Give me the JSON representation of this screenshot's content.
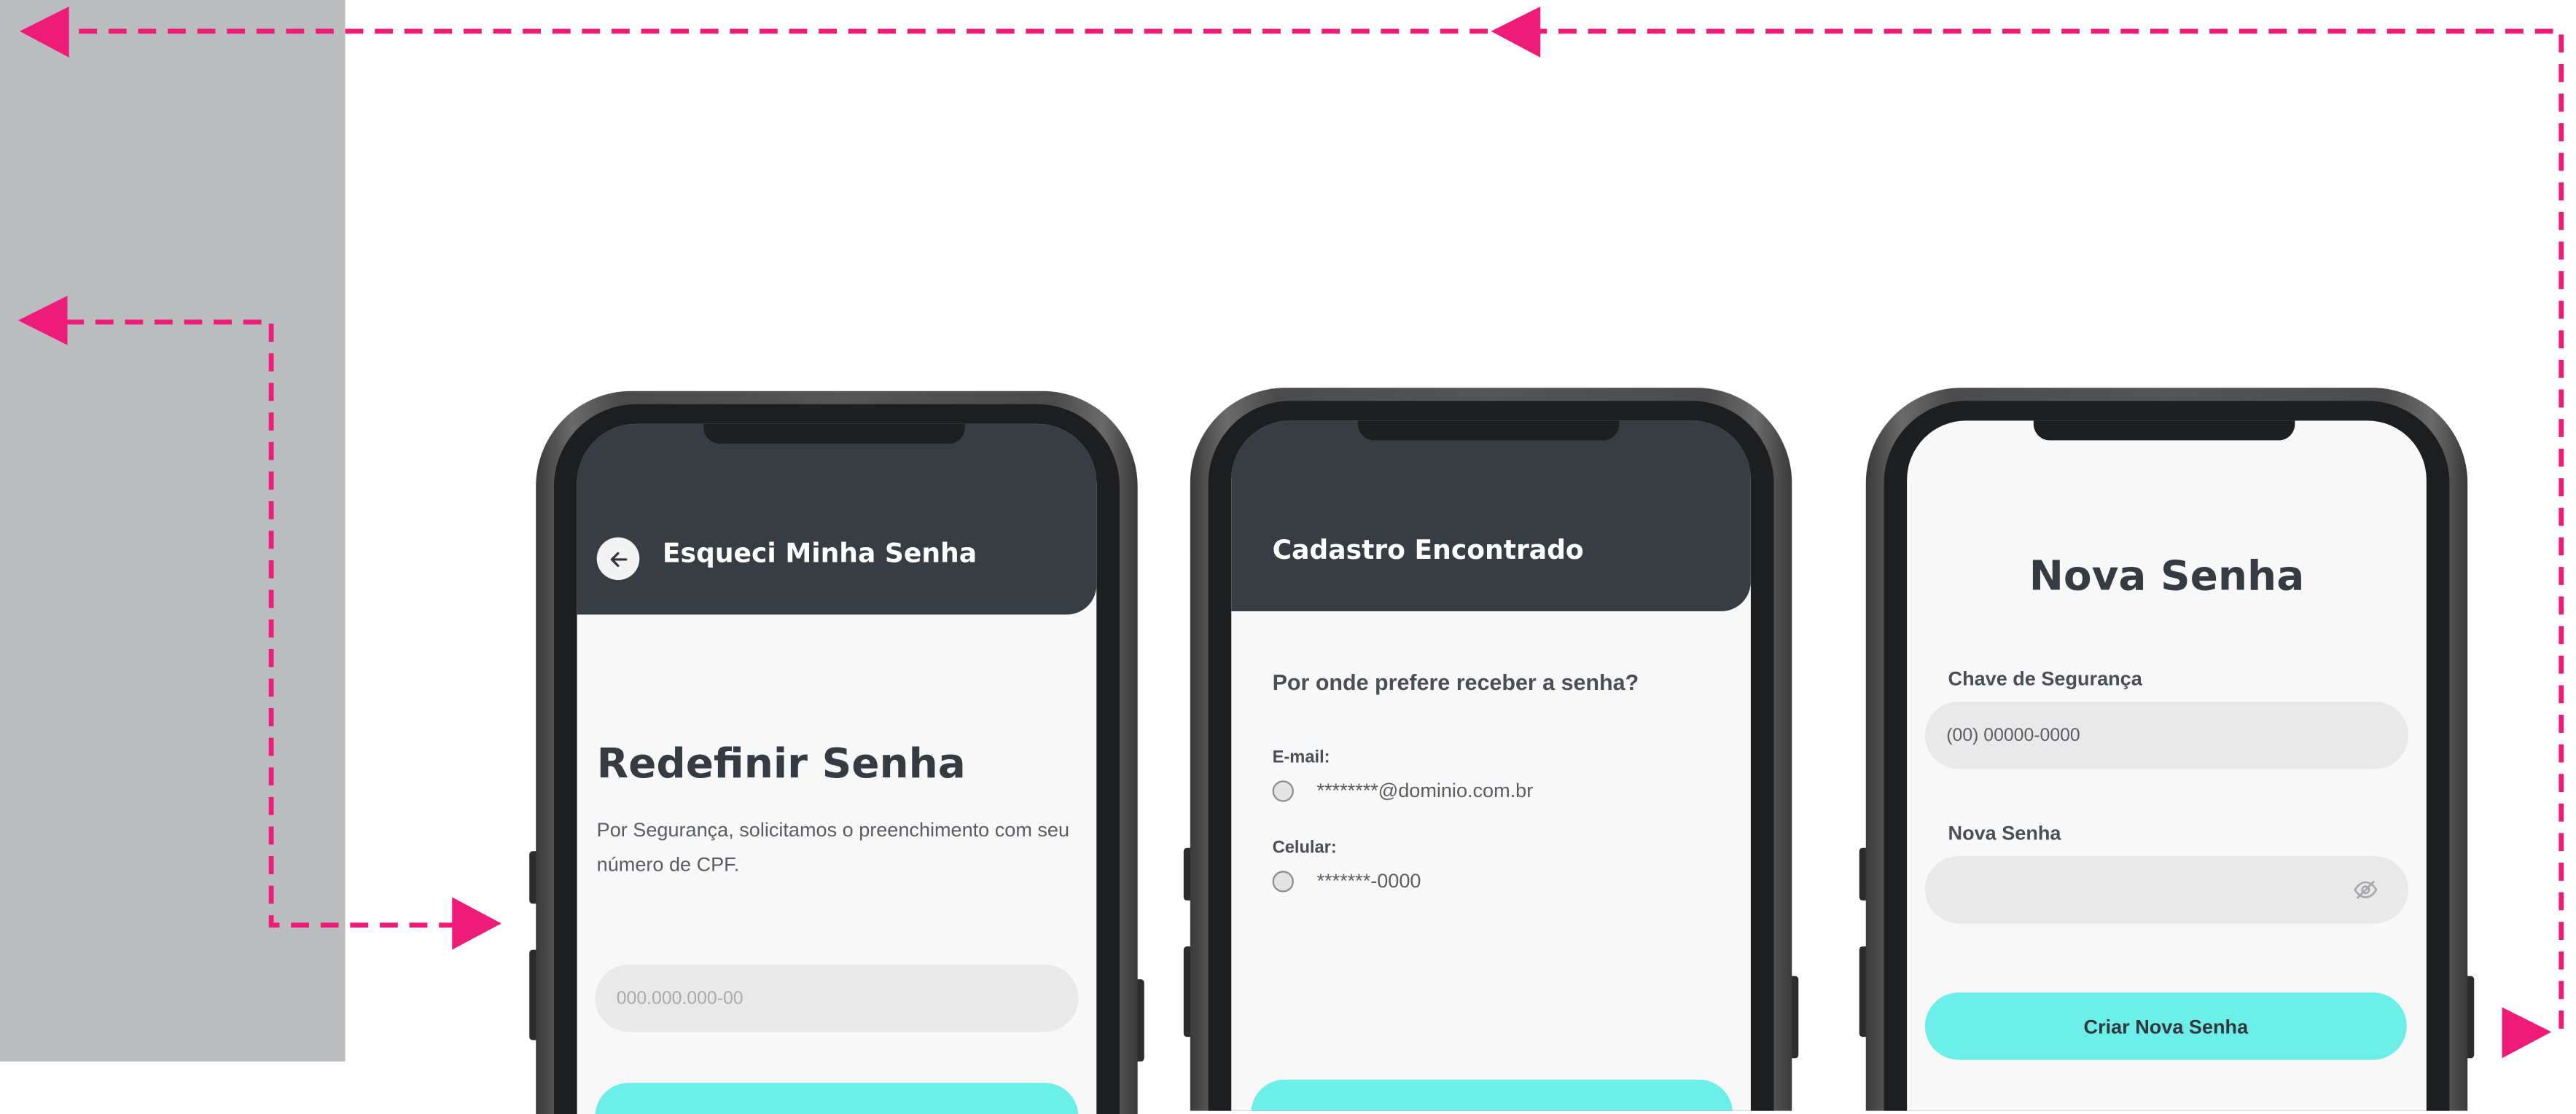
{
  "colors": {
    "accent_pink": "#ee1c78",
    "app_bar": "#383c43",
    "button_cyan": "#6ceee9",
    "side_panel": "#bbbcbe"
  },
  "screens": {
    "forgot": {
      "appbar_title": "Esqueci Minha Senha",
      "back_icon": "arrow-left-icon",
      "heading": "Redefinir Senha",
      "description": "Por Segurança, solicitamos o preenchimento com seu número de CPF.",
      "cpf_placeholder": "000.000.000-00"
    },
    "found": {
      "appbar_title": "Cadastro Encontrado",
      "question": "Por onde prefere receber a senha?",
      "options": [
        {
          "label": "E-mail:",
          "value": "********@dominio.com.br"
        },
        {
          "label": "Celular:",
          "value": "*******-0000"
        }
      ]
    },
    "new_password": {
      "heading": "Nova Senha",
      "security_key_label": "Chave de Segurança",
      "security_key_value": "(00) 00000-0000",
      "new_password_label": "Nova Senha",
      "visibility_icon": "eye-off-icon",
      "submit_label": "Criar Nova Senha"
    }
  }
}
